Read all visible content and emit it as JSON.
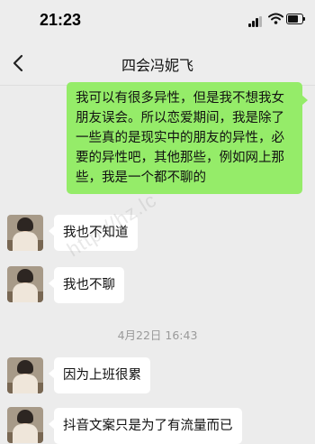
{
  "status_bar": {
    "time": "21:23"
  },
  "header": {
    "title": "四会冯妮飞"
  },
  "messages": [
    {
      "sender": "self",
      "text": "我可以有很多异性，但是我不想我女朋友误会。所以恋爱期间，我是除了一些真的是现实中的朋友的异性，必要的异性吧，其他那些，例如网上那些，我是一个都不聊的"
    },
    {
      "sender": "peer",
      "text": "我也不知道"
    },
    {
      "sender": "peer",
      "text": "我也不聊"
    },
    {
      "sender": "peer",
      "text": "因为上班很累"
    },
    {
      "sender": "peer",
      "text": "抖音文案只是为了有流量而已"
    }
  ],
  "timestamp": "4月22日 16:43",
  "watermark": "http://hz.lc",
  "colors": {
    "self_bubble": "#95ec69",
    "peer_bubble": "#ffffff",
    "background": "#ececec"
  },
  "icons": [
    "signal-icon",
    "wifi-icon",
    "battery-icon",
    "back-arrow-icon"
  ]
}
